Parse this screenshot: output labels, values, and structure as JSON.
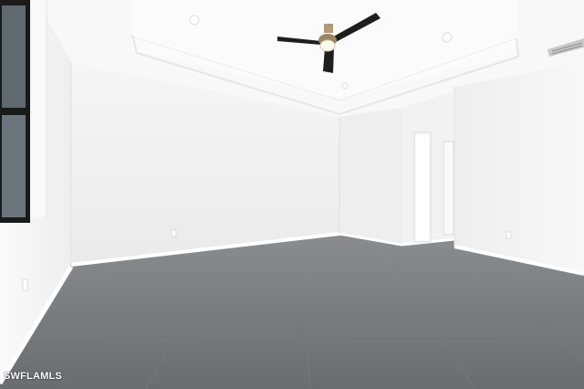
{
  "watermark": {
    "text": "SWFLAMLS"
  },
  "colors": {
    "wall": "#f3f3f3",
    "ceiling": "#f7f7f7",
    "floor": "#6f7275",
    "trim": "#ffffff",
    "fan_blade": "#1e1e1e",
    "fan_motor": "#b49a6e"
  },
  "icons": [
    "ceiling-fan-icon",
    "recessed-light-icon",
    "air-vent-icon",
    "window-icon",
    "door-icon",
    "outlet-icon"
  ]
}
